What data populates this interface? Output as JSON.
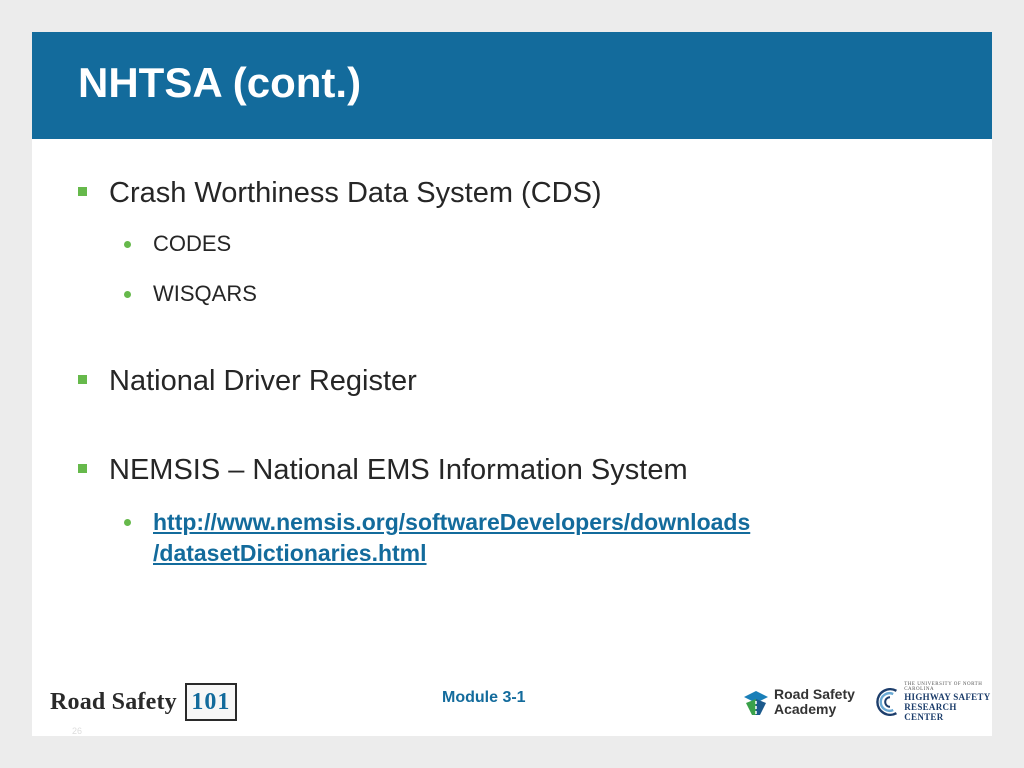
{
  "slide": {
    "title": "NHTSA (cont.)",
    "items": [
      {
        "label": "Crash Worthiness Data System (CDS)",
        "subitems": [
          "CODES",
          "WISQARS"
        ]
      },
      {
        "label": "National Driver Register"
      },
      {
        "label": "NEMSIS – National EMS Information System",
        "link": {
          "line1": "http://www.nemsis.org/softwareDevelopers/downloads",
          "line2": "/datasetDictionaries.html"
        }
      }
    ]
  },
  "footer": {
    "road_safety_word": "Road Safety",
    "road_safety_number": "101",
    "module": "Module 3-1",
    "rsa_line1": "Road Safety",
    "rsa_line2": "Academy",
    "hsrc_small": "THE UNIVERSITY OF NORTH CAROLINA",
    "hsrc_line1": "HIGHWAY SAFETY",
    "hsrc_line2": "RESEARCH CENTER",
    "page_number": "26"
  },
  "colors": {
    "title_bar": "#136b9c",
    "bullet": "#66b94b",
    "link": "#136b9c",
    "background": "#ececec"
  }
}
